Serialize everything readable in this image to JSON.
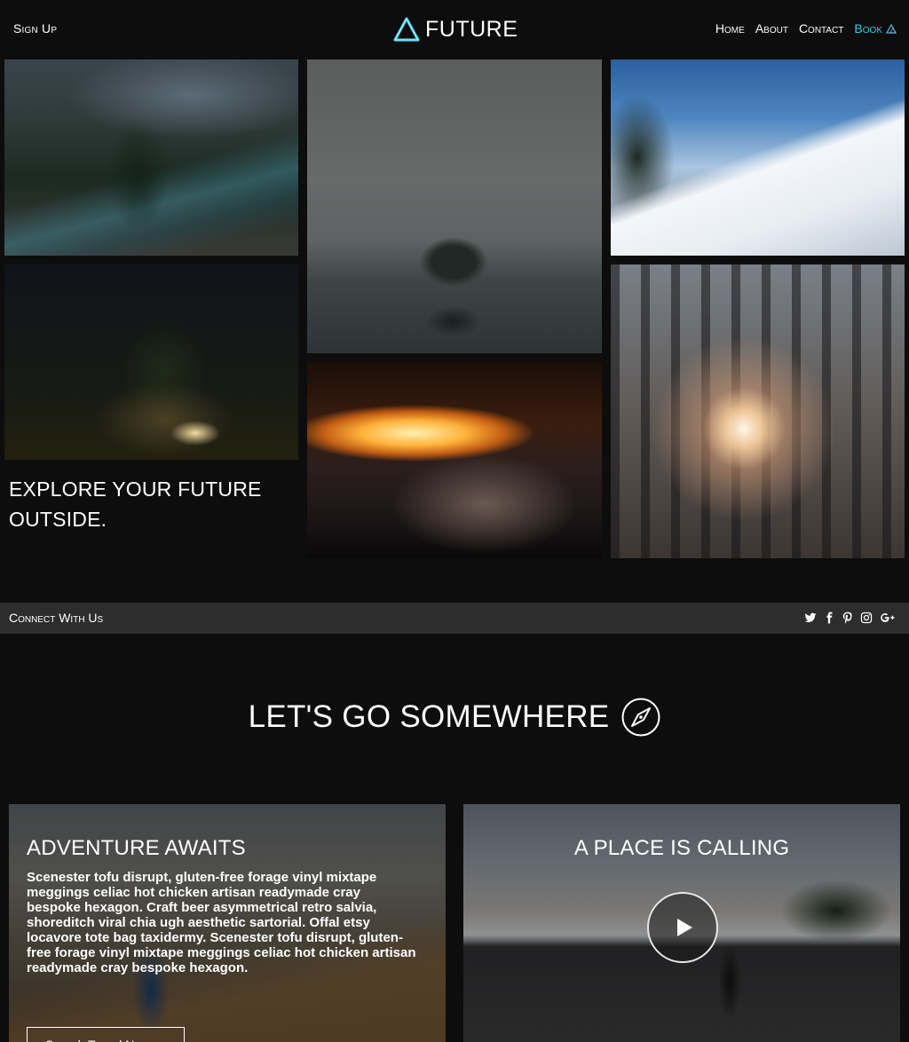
{
  "header": {
    "signup": "Sign Up",
    "logo": "FUTURE",
    "nav": {
      "home": "Home",
      "about": "About",
      "contact": "Contact",
      "book": "Book"
    }
  },
  "gallery": {
    "images": [
      "forest-river-photo",
      "misty-lake-island-photo",
      "snowy-mountain-hiker-photo",
      "starry-night-tent-photo",
      "sunset-clouds-photo",
      "forest-sunbeam-photo"
    ],
    "tagline": "EXPLORE YOUR FUTURE OUTSIDE."
  },
  "connect": {
    "label": "Connect With Us",
    "icons": [
      "twitter-icon",
      "facebook-icon",
      "pinterest-icon",
      "instagram-icon",
      "google-plus-icon"
    ]
  },
  "section": {
    "title": "LET'S GO SOMEWHERE",
    "icon": "compass-icon"
  },
  "cards": {
    "left": {
      "title": "ADVENTURE AWAITS",
      "body": "Scenester tofu disrupt, gluten-free forage vinyl mixtape meggings celiac hot chicken artisan readymade cray bespoke hexagon. Craft beer asymmetrical retro salvia, shoreditch viral chia ugh aesthetic sartorial. Offal etsy locavore tote bag taxidermy. Scenester tofu disrupt, gluten-free forage vinyl mixtape meggings celiac hot chicken artisan readymade cray bespoke hexagon.",
      "button": "Search Travel Now"
    },
    "right": {
      "title": "A PLACE IS CALLING",
      "play_icon": "play-icon"
    }
  },
  "colors": {
    "background": "#0d0d0d",
    "accent": "#3ec7e6",
    "bar": "#2d2d2d"
  }
}
